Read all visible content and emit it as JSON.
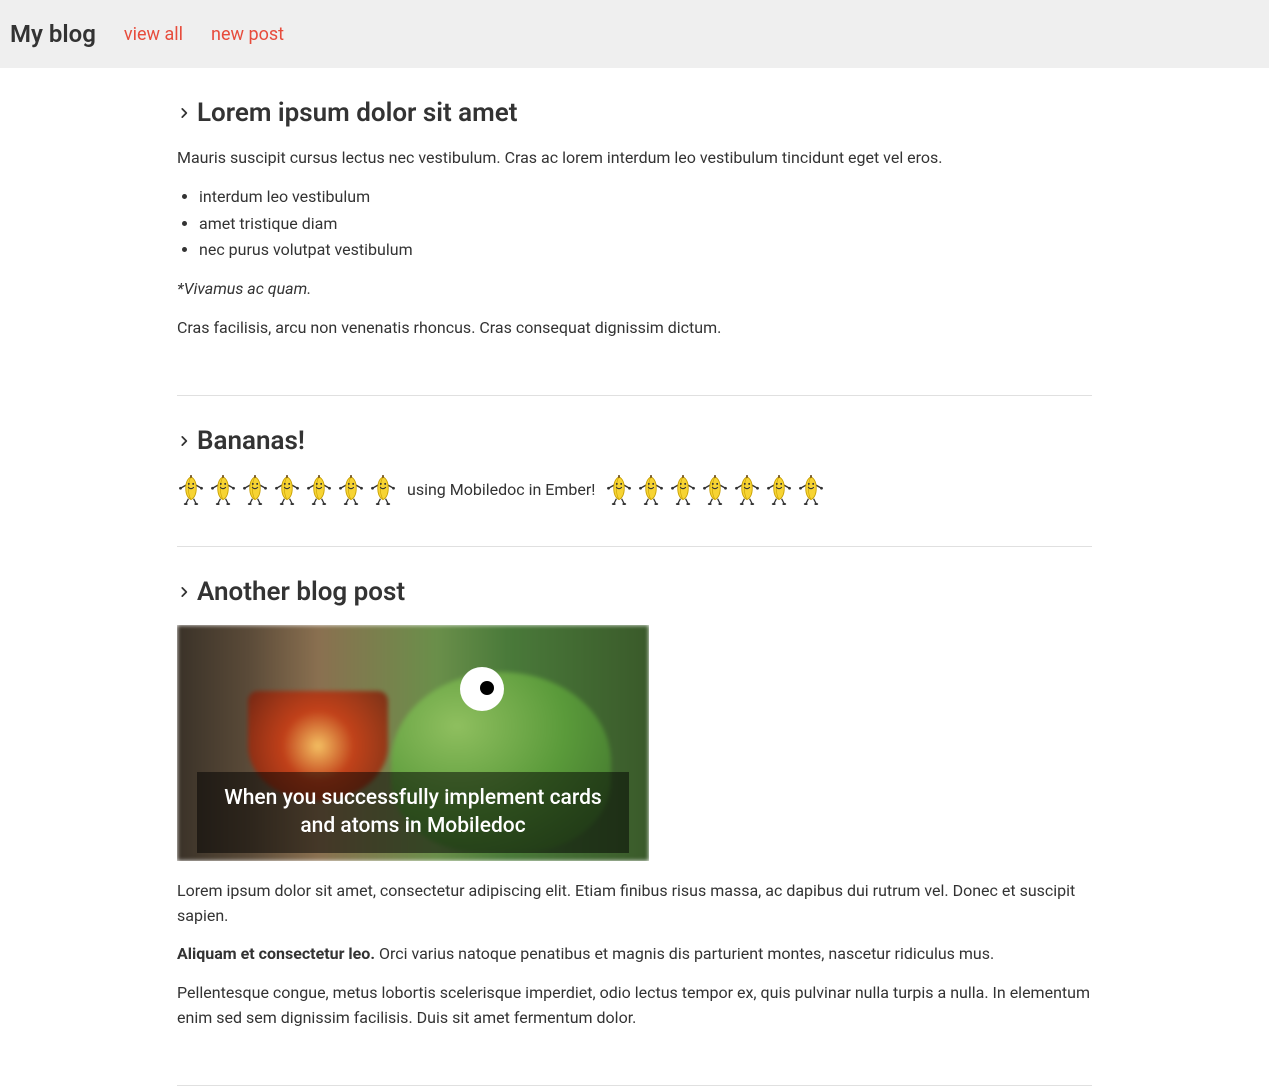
{
  "header": {
    "site_title": "My blog",
    "nav": {
      "view_all": "view all",
      "new_post": "new post"
    }
  },
  "posts": [
    {
      "title": "Lorem ipsum dolor sit amet",
      "intro": "Mauris suscipit cursus lectus nec vestibulum. Cras ac lorem interdum leo vestibulum tincidunt eget vel eros.",
      "bullets": [
        "interdum leo vestibulum",
        "amet tristique diam",
        "nec purus volutpat vestibulum"
      ],
      "note": "*Vivamus ac quam.",
      "outro": "Cras facilisis, arcu non venenatis rhoncus. Cras consequat dignissim dictum."
    },
    {
      "title": "Bananas!",
      "left_count": 7,
      "mid_text": "using Mobiledoc in Ember!",
      "right_count": 7
    },
    {
      "title": "Another blog post",
      "image_caption": "When you successfully implement cards and atoms in Mobiledoc",
      "para1": "Lorem ipsum dolor sit amet, consectetur adipiscing elit. Etiam finibus risus massa, ac dapibus dui rutrum vel. Donec et suscipit sapien.",
      "para2_bold": "Aliquam et consectetur leo.",
      "para2_rest": " Orci varius natoque penatibus et magnis dis parturient montes, nascetur ridiculus mus.",
      "para3": "Pellentesque congue, metus lobortis scelerisque imperdiet, odio lectus tempor ex, quis pulvinar nulla turpis a nulla. In elementum enim sed sem dignissim facilisis. Duis sit amet fermentum dolor."
    }
  ]
}
